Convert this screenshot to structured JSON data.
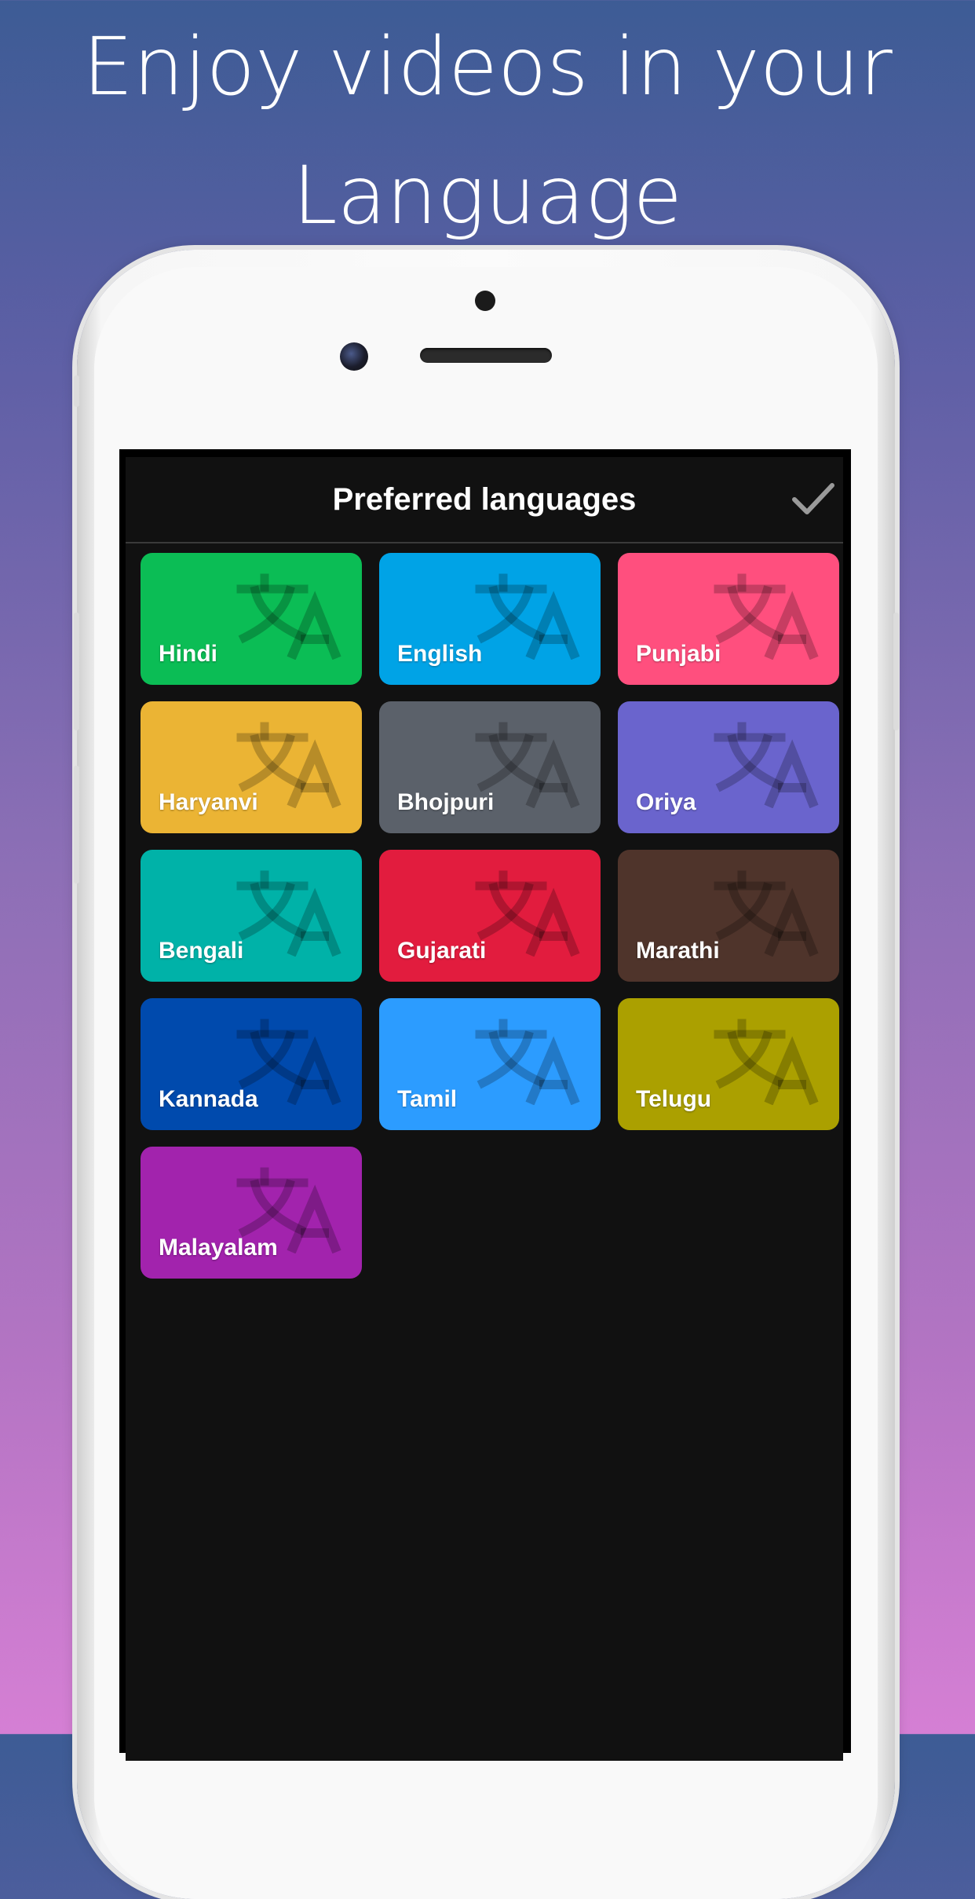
{
  "headline": {
    "line1": "Enjoy videos in your",
    "line2": "Language"
  },
  "app": {
    "title": "Preferred languages",
    "confirm_icon": "checkmark-icon",
    "tile_icon": "translate-icon"
  },
  "languages": [
    {
      "label": "Hindi",
      "color": "#0bbd55"
    },
    {
      "label": "English",
      "color": "#00a3e6"
    },
    {
      "label": "Punjabi",
      "color": "#ff4f7e"
    },
    {
      "label": "Haryanvi",
      "color": "#ebb434"
    },
    {
      "label": "Bhojpuri",
      "color": "#5b616a"
    },
    {
      "label": "Oriya",
      "color": "#6a64cd"
    },
    {
      "label": "Bengali",
      "color": "#00b2a8"
    },
    {
      "label": "Gujarati",
      "color": "#e21c3e"
    },
    {
      "label": "Marathi",
      "color": "#4f342b"
    },
    {
      "label": "Kannada",
      "color": "#004aad"
    },
    {
      "label": "Tamil",
      "color": "#2c9cff"
    },
    {
      "label": "Telugu",
      "color": "#aba000"
    },
    {
      "label": "Malayalam",
      "color": "#a223ad"
    }
  ]
}
